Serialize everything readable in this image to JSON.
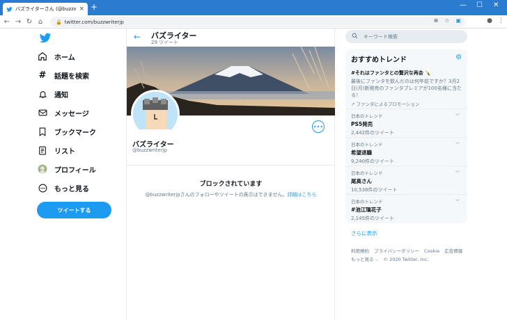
{
  "browser": {
    "tab_title": "バズライターさん (@buzzwriterjp) / T",
    "tab_close": "×",
    "new_tab": "+",
    "url": "twitter.com/buzzwriterjp"
  },
  "nav": [
    {
      "label": "ホーム",
      "icon": "home-icon"
    },
    {
      "label": "話題を検索",
      "icon": "hashtag-icon"
    },
    {
      "label": "通知",
      "icon": "bell-icon"
    },
    {
      "label": "メッセージ",
      "icon": "mail-icon"
    },
    {
      "label": "ブックマーク",
      "icon": "bookmark-icon"
    },
    {
      "label": "リスト",
      "icon": "list-icon"
    },
    {
      "label": "プロフィール",
      "icon": "profile-avatar-icon"
    },
    {
      "label": "もっと見る",
      "icon": "more-circle-icon"
    }
  ],
  "tweet_button": "ツイートする",
  "profile": {
    "header_title": "バズライター",
    "tweet_count": "29 ツイート",
    "name": "バズライター",
    "handle": "@buzzwriterjp",
    "more_symbol": "•••"
  },
  "blocked": {
    "title": "ブロックされています",
    "message": "@buzzwriterjpさんのフォローやツイートの表示はできません。",
    "link": "詳細はこちら"
  },
  "search": {
    "placeholder": "キーワード検索"
  },
  "trends": {
    "title": "おすすめトレンド",
    "promo": {
      "tag": "#それはファンタとの贅沢な再会 🍾",
      "body": "最後にファンタを飲んだのは何年前ですか？3月2日(月)新発売のファンタプレミアが100名様に当たる！",
      "by": "ファンタによるプロモーション"
    },
    "items": [
      {
        "category": "日本のトレンド",
        "name": "PS5発売",
        "count": "2,442件のツイート"
      },
      {
        "category": "日本のトレンド",
        "name": "希望退職",
        "count": "9,240件のツイート"
      },
      {
        "category": "日本のトレンド",
        "name": "尾高さん",
        "count": "10,538件のツイート"
      },
      {
        "category": "日本のトレンド",
        "name": "#池江璃花子",
        "count": "2,145件のツイート"
      }
    ],
    "show_more": "さらに表示"
  },
  "footer": {
    "links": [
      "利用規約",
      "プライバシーポリシー",
      "Cookie",
      "広告情報"
    ],
    "more": "もっと見る ⌵",
    "copyright": "© 2020 Twitter, Inc."
  },
  "colors": {
    "accent": "#1d9bf0",
    "chrome": "#2b7bd0"
  }
}
